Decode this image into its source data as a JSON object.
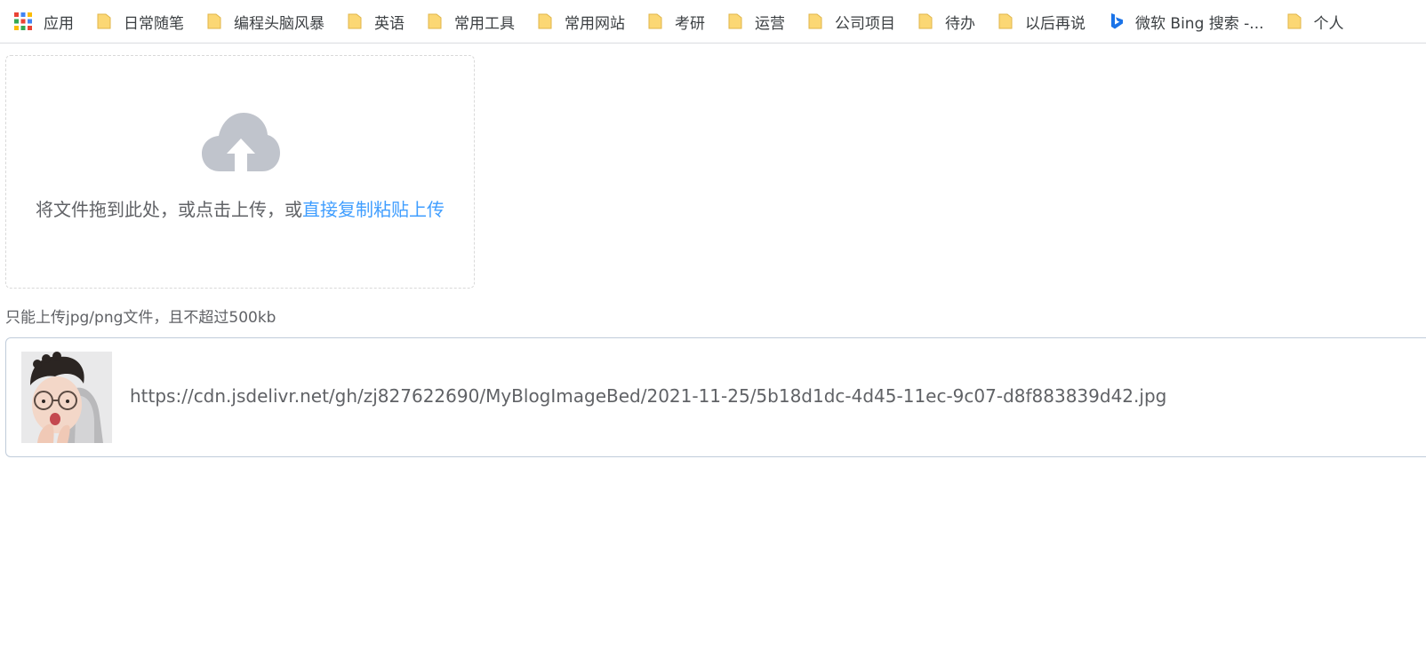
{
  "bookmarks": [
    {
      "label": "应用",
      "icon": "apps-grid-icon"
    },
    {
      "label": "日常随笔",
      "icon": "folder-icon"
    },
    {
      "label": "编程头脑风暴",
      "icon": "folder-icon"
    },
    {
      "label": "英语",
      "icon": "folder-icon"
    },
    {
      "label": "常用工具",
      "icon": "folder-icon"
    },
    {
      "label": "常用网站",
      "icon": "folder-icon"
    },
    {
      "label": "考研",
      "icon": "folder-icon"
    },
    {
      "label": "运营",
      "icon": "folder-icon"
    },
    {
      "label": "公司项目",
      "icon": "folder-icon"
    },
    {
      "label": "待办",
      "icon": "folder-icon"
    },
    {
      "label": "以后再说",
      "icon": "folder-icon"
    },
    {
      "label": "微软 Bing 搜索 -...",
      "icon": "bing-icon"
    },
    {
      "label": "个人",
      "icon": "folder-icon"
    }
  ],
  "upload": {
    "text": "将文件拖到此处，或点击上传，或",
    "link": "直接复制粘贴上传",
    "tip": "只能上传jpg/png文件，且不超过500kb"
  },
  "file": {
    "url": "https://cdn.jsdelivr.net/gh/zj827622690/MyBlogImageBed/2021-11-25/5b18d1dc-4d45-11ec-9c07-d8f883839d42.jpg"
  },
  "colors": {
    "link": "#409eff",
    "text": "#606266",
    "folder": "#fbd774",
    "cloud": "#c0c4cc",
    "border_dashed": "#d9d9d9",
    "border_item": "#c0ccda"
  }
}
